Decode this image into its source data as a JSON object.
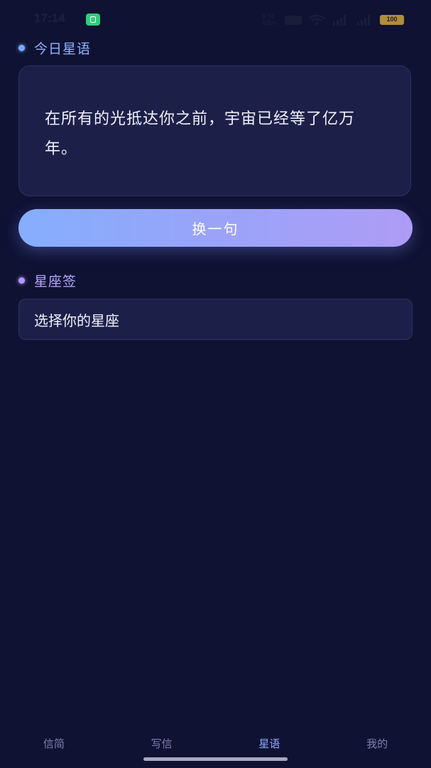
{
  "status_bar": {
    "time": "17:14",
    "network_speed": "0.70 KB/s",
    "hd_badge": "HD",
    "battery": "100"
  },
  "daily_quote": {
    "section_title": "今日星语",
    "text": "在所有的光抵达你之前，宇宙已经等了亿万年。",
    "refresh_label": "换一句"
  },
  "zodiac": {
    "section_title": "星座签",
    "select_placeholder": "选择你的星座"
  },
  "tab_bar": {
    "active": "星语",
    "tabs": [
      {
        "label": "信简"
      },
      {
        "label": "写信"
      },
      {
        "label": "星语"
      },
      {
        "label": "我的"
      }
    ]
  },
  "colors": {
    "background": "#0f1232",
    "card": "#1c2049",
    "accent_blue": "#86aefc",
    "accent_purple": "#ae9cf6"
  }
}
